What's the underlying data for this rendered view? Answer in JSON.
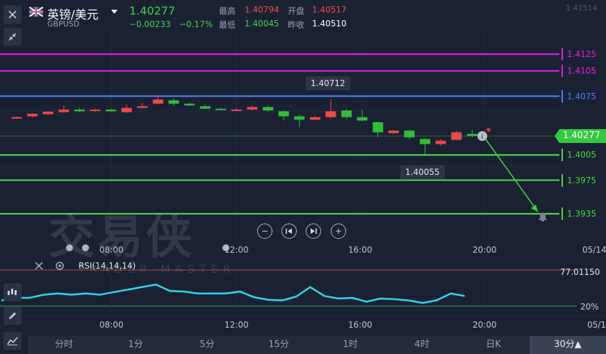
{
  "header": {
    "pair_name": "英镑/美元",
    "pair_code": "GBPUSD",
    "last_price": "1.40277",
    "change": "−0.00233",
    "change_pct": "−0.17%",
    "stats": [
      {
        "label": "最高",
        "value": "1.40794",
        "color": "#f0494d"
      },
      {
        "label": "开盘",
        "value": "1.40517",
        "color": "#f0494d"
      },
      {
        "label": "最低",
        "value": "1.40045",
        "color": "#3fd34a"
      },
      {
        "label": "昨收",
        "value": "1.40510",
        "color": "#ffffff"
      }
    ]
  },
  "axis_top_label": "1.41514",
  "levels": [
    {
      "value": "1.4125",
      "color": "#e21ee2"
    },
    {
      "value": "1.4105",
      "color": "#e21ee2"
    },
    {
      "value": "1.4075",
      "color": "#4e7bf0"
    },
    {
      "value": "1.4005",
      "color": "#4cd83b"
    },
    {
      "value": "1.3975",
      "color": "#4cd83b"
    },
    {
      "value": "1.3935",
      "color": "#4cd83b"
    }
  ],
  "current_price_label": "1.40277",
  "high_tooltip": "1.40712",
  "low_tooltip": "1.40055",
  "time_axis": [
    "08:00",
    "12:00",
    "16:00",
    "20:00",
    "05/14"
  ],
  "rsi": {
    "label": "RSI(14,14,14)",
    "upper_value": "77.01150",
    "lower_value": "20%",
    "values": [
      29,
      33,
      33,
      38,
      40,
      38,
      40,
      38,
      42,
      46,
      50,
      54,
      44,
      43,
      40,
      40,
      40,
      43,
      34,
      30,
      29,
      35,
      50,
      36,
      32,
      33,
      27,
      32,
      31,
      29,
      25,
      29,
      40,
      36
    ]
  },
  "watermark": {
    "cn": "交易侠",
    "en": "TRADER MASTER"
  },
  "tabs": [
    "分时",
    "1分",
    "5分",
    "15分",
    "1时",
    "4时",
    "日K",
    "30分▲"
  ],
  "active_tab": 7,
  "candles": [
    {
      "o": 1.4049,
      "c": 1.405,
      "h": 1.4051,
      "l": 1.4048
    },
    {
      "o": 1.4051,
      "c": 1.4054,
      "h": 1.4055,
      "l": 1.405
    },
    {
      "o": 1.40535,
      "c": 1.40565,
      "h": 1.40575,
      "l": 1.40525
    },
    {
      "o": 1.4056,
      "c": 1.4059,
      "h": 1.4064,
      "l": 1.4055
    },
    {
      "o": 1.4059,
      "c": 1.4057,
      "h": 1.4061,
      "l": 1.4056
    },
    {
      "o": 1.40575,
      "c": 1.4059,
      "h": 1.406,
      "l": 1.40565
    },
    {
      "o": 1.4059,
      "c": 1.4057,
      "h": 1.406,
      "l": 1.40565
    },
    {
      "o": 1.4056,
      "c": 1.4061,
      "h": 1.4065,
      "l": 1.4055
    },
    {
      "o": 1.4061,
      "c": 1.4063,
      "h": 1.4067,
      "l": 1.406
    },
    {
      "o": 1.4066,
      "c": 1.4071,
      "h": 1.4076,
      "l": 1.4065
    },
    {
      "o": 1.407,
      "c": 1.4066,
      "h": 1.4072,
      "l": 1.4064
    },
    {
      "o": 1.4066,
      "c": 1.4064,
      "h": 1.4067,
      "l": 1.4063
    },
    {
      "o": 1.4063,
      "c": 1.406,
      "h": 1.4065,
      "l": 1.4059
    },
    {
      "o": 1.406,
      "c": 1.4059,
      "h": 1.4061,
      "l": 1.4058
    },
    {
      "o": 1.40585,
      "c": 1.4059,
      "h": 1.4061,
      "l": 1.4058
    },
    {
      "o": 1.4059,
      "c": 1.4062,
      "h": 1.4064,
      "l": 1.4058
    },
    {
      "o": 1.4062,
      "c": 1.4058,
      "h": 1.4064,
      "l": 1.4056
    },
    {
      "o": 1.4057,
      "c": 1.4051,
      "h": 1.4058,
      "l": 1.4046
    },
    {
      "o": 1.4051,
      "c": 1.4047,
      "h": 1.4053,
      "l": 1.4038
    },
    {
      "o": 1.4047,
      "c": 1.405,
      "h": 1.4052,
      "l": 1.4046
    },
    {
      "o": 1.405,
      "c": 1.4057,
      "h": 1.40712,
      "l": 1.4048
    },
    {
      "o": 1.4058,
      "c": 1.405,
      "h": 1.406,
      "l": 1.4048
    },
    {
      "o": 1.405,
      "c": 1.4046,
      "h": 1.4059,
      "l": 1.4045
    },
    {
      "o": 1.4044,
      "c": 1.4032,
      "h": 1.4045,
      "l": 1.4026
    },
    {
      "o": 1.4031,
      "c": 1.4034,
      "h": 1.4035,
      "l": 1.403
    },
    {
      "o": 1.4034,
      "c": 1.4026,
      "h": 1.4035,
      "l": 1.4024
    },
    {
      "o": 1.4024,
      "c": 1.4018,
      "h": 1.4025,
      "l": 1.40055
    },
    {
      "o": 1.4018,
      "c": 1.4022,
      "h": 1.4024,
      "l": 1.4016
    },
    {
      "o": 1.4023,
      "c": 1.4032,
      "h": 1.4034,
      "l": 1.4022
    },
    {
      "o": 1.403,
      "c": 1.40277,
      "h": 1.4035,
      "l": 1.4026
    }
  ],
  "colors": {
    "up": "#f0494d",
    "down": "#2fbf3a",
    "rsi_line": "#2fd6e6",
    "bg": "#1a2133"
  }
}
